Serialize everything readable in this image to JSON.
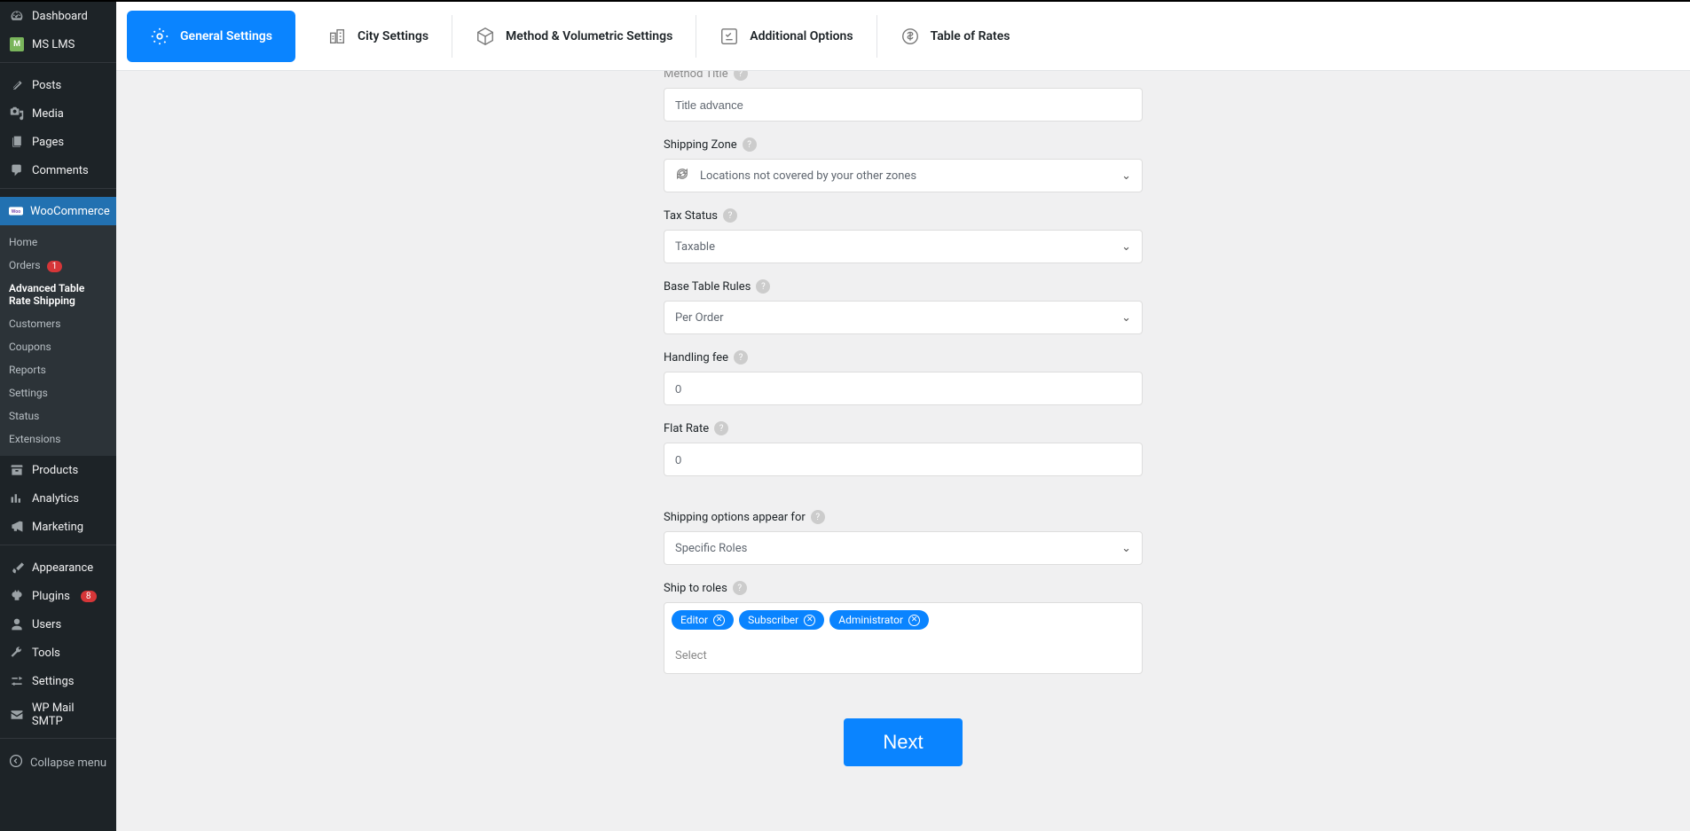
{
  "sidebar": {
    "items": [
      {
        "id": "dashboard",
        "label": "Dashboard",
        "icon": "gauge"
      },
      {
        "id": "mslms",
        "label": "MS LMS",
        "icon": "ms"
      },
      {
        "id": "posts",
        "label": "Posts",
        "icon": "pin"
      },
      {
        "id": "media",
        "label": "Media",
        "icon": "media"
      },
      {
        "id": "pages",
        "label": "Pages",
        "icon": "pages"
      },
      {
        "id": "comments",
        "label": "Comments",
        "icon": "comment"
      },
      {
        "id": "woocommerce",
        "label": "WooCommerce",
        "icon": "woo",
        "active": true
      },
      {
        "id": "products",
        "label": "Products",
        "icon": "archive"
      },
      {
        "id": "analytics",
        "label": "Analytics",
        "icon": "bars"
      },
      {
        "id": "marketing",
        "label": "Marketing",
        "icon": "megaphone"
      },
      {
        "id": "appearance",
        "label": "Appearance",
        "icon": "brush"
      },
      {
        "id": "plugins",
        "label": "Plugins",
        "icon": "plug",
        "badge": "8"
      },
      {
        "id": "users",
        "label": "Users",
        "icon": "user"
      },
      {
        "id": "tools",
        "label": "Tools",
        "icon": "wrench"
      },
      {
        "id": "settings",
        "label": "Settings",
        "icon": "sliders"
      },
      {
        "id": "wpmail",
        "label": "WP Mail SMTP",
        "icon": "mail"
      }
    ],
    "submenu": [
      {
        "label": "Home"
      },
      {
        "label": "Orders",
        "badge": "1"
      },
      {
        "label": "Advanced Table Rate Shipping",
        "current": true
      },
      {
        "label": "Customers"
      },
      {
        "label": "Coupons"
      },
      {
        "label": "Reports"
      },
      {
        "label": "Settings"
      },
      {
        "label": "Status"
      },
      {
        "label": "Extensions"
      }
    ],
    "collapse": "Collapse menu"
  },
  "tabs": [
    {
      "label": "General Settings",
      "icon": "gear",
      "active": true
    },
    {
      "label": "City Settings",
      "icon": "city"
    },
    {
      "label": "Method & Volumetric Settings",
      "icon": "cube"
    },
    {
      "label": "Additional Options",
      "icon": "checklist"
    },
    {
      "label": "Table of Rates",
      "icon": "dollar"
    }
  ],
  "form": {
    "method_title": {
      "label": "Method Title",
      "value": "Title advance"
    },
    "shipping_zone": {
      "label": "Shipping Zone",
      "value": "Locations not covered by your other zones"
    },
    "tax_status": {
      "label": "Tax Status",
      "value": "Taxable"
    },
    "base_table_rules": {
      "label": "Base Table Rules",
      "value": "Per Order"
    },
    "handling_fee": {
      "label": "Handling fee",
      "value": "0"
    },
    "flat_rate": {
      "label": "Flat Rate",
      "value": "0"
    },
    "appear_for": {
      "label": "Shipping options appear for",
      "value": "Specific Roles"
    },
    "ship_to_roles": {
      "label": "Ship to roles",
      "tags": [
        "Editor",
        "Subscriber",
        "Administrator"
      ],
      "placeholder": "Select"
    },
    "next": "Next"
  }
}
